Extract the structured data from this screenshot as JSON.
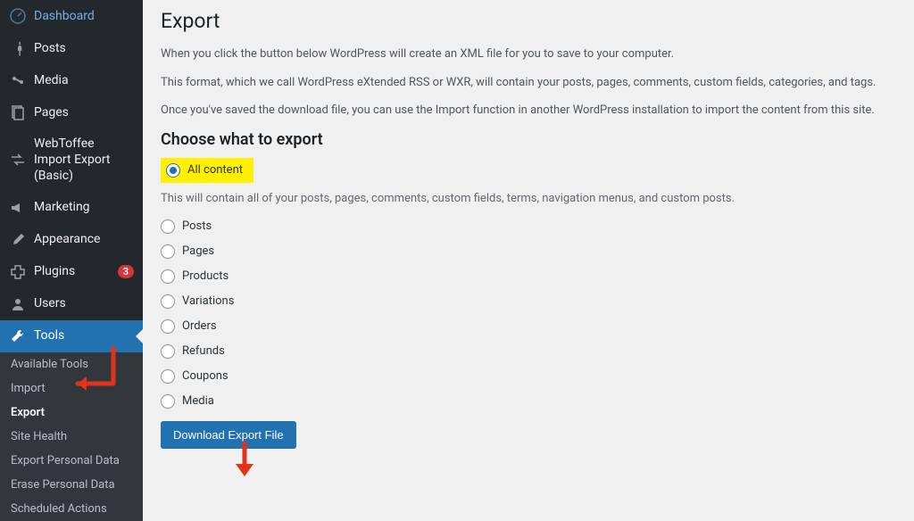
{
  "sidebar": {
    "items": [
      {
        "label": "Dashboard",
        "icon": "dashboard"
      },
      {
        "label": "Posts",
        "icon": "pin"
      },
      {
        "label": "Media",
        "icon": "media"
      },
      {
        "label": "Pages",
        "icon": "pages"
      },
      {
        "label": "WebToffee Import Export (Basic)",
        "icon": "swap"
      },
      {
        "label": "Marketing",
        "icon": "megaphone"
      },
      {
        "label": "Appearance",
        "icon": "brush"
      },
      {
        "label": "Plugins",
        "icon": "plugin",
        "badge": "3"
      },
      {
        "label": "Users",
        "icon": "users"
      },
      {
        "label": "Tools",
        "icon": "wrench",
        "active": true
      }
    ],
    "subitems": [
      {
        "label": "Available Tools"
      },
      {
        "label": "Import"
      },
      {
        "label": "Export",
        "active": true
      },
      {
        "label": "Site Health"
      },
      {
        "label": "Export Personal Data"
      },
      {
        "label": "Erase Personal Data"
      },
      {
        "label": "Scheduled Actions"
      }
    ]
  },
  "main": {
    "title": "Export",
    "intro": [
      "When you click the button below WordPress will create an XML file for you to save to your computer.",
      "This format, which we call WordPress eXtended RSS or WXR, will contain your posts, pages, comments, custom fields, categories, and tags.",
      "Once you've saved the download file, you can use the Import function in another WordPress installation to import the content from this site."
    ],
    "section_title": "Choose what to export",
    "options": {
      "all_content": "All content",
      "all_content_desc": "This will contain all of your posts, pages, comments, custom fields, terms, navigation menus, and custom posts.",
      "items": [
        "Posts",
        "Pages",
        "Products",
        "Variations",
        "Orders",
        "Refunds",
        "Coupons",
        "Media"
      ]
    },
    "download_button": "Download Export File"
  }
}
